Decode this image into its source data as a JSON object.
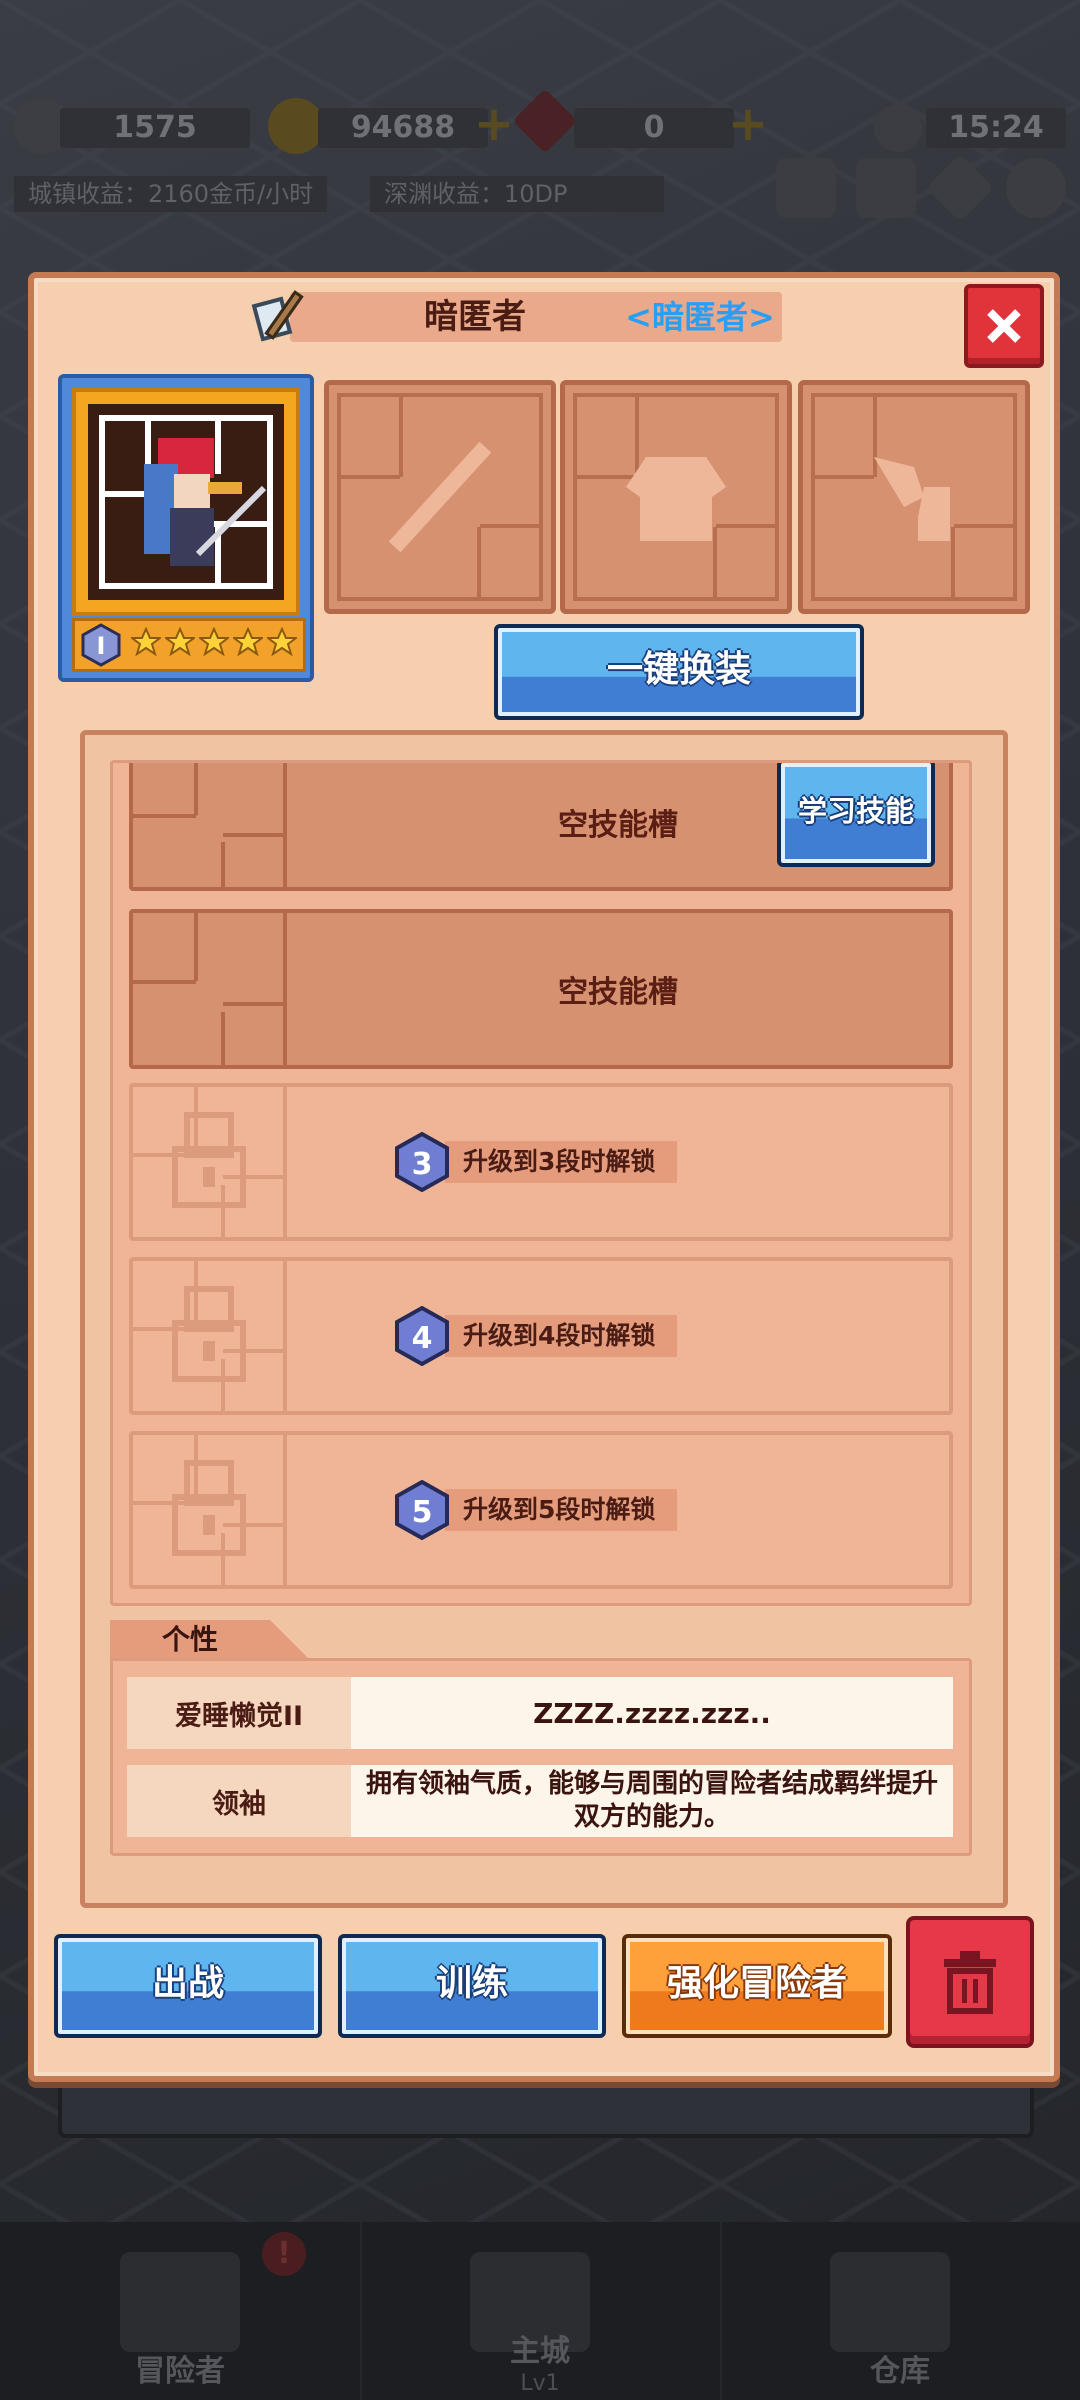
{
  "hud": {
    "power": "1575",
    "gold": "94688",
    "gems": "0",
    "time": "15:24",
    "town_income": "城镇收益：2160金币/小时",
    "abyss_income": "深渊收益：10DP"
  },
  "dialog": {
    "title_name": "暗匿者",
    "title_class": "<暗匿者>",
    "rank": "I",
    "stars": 5,
    "quick_equip_label": "一键换装"
  },
  "skills": {
    "learn_button": "学习技能",
    "slots": [
      {
        "label": "空技能槽"
      },
      {
        "label": "空技能槽"
      },
      {
        "level": "3",
        "label": "升级到3段时解锁"
      },
      {
        "level": "4",
        "label": "升级到4段时解锁"
      },
      {
        "level": "5",
        "label": "升级到5段时解锁"
      }
    ]
  },
  "personality": {
    "tab_label": "个性",
    "traits": [
      {
        "name": "爱睡懒觉II",
        "desc": "ZZZZ.zzzz.zzz.."
      },
      {
        "name": "领袖",
        "desc": "拥有领袖气质，能够与周围的冒险者结成羁绊提升双方的能力。"
      }
    ]
  },
  "actions": {
    "battle": "出战",
    "train": "训练",
    "enhance": "强化冒险者"
  },
  "nav": {
    "adventurer": "冒险者",
    "main_city": "主城",
    "main_city_level": "Lv1",
    "warehouse": "仓库"
  },
  "colors": {
    "dialog_bg": "#f5cfae",
    "button_blue": "#5fb6ef",
    "button_orange": "#ffa13a",
    "close_red": "#e0343a",
    "class_text": "#2a9ef2"
  }
}
